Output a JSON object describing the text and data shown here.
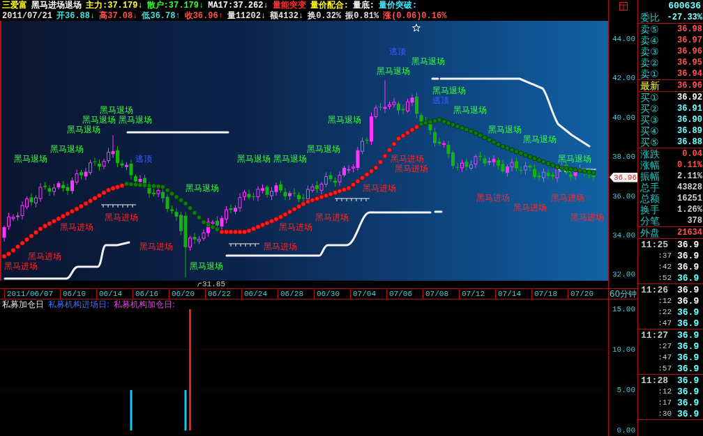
{
  "header": {
    "lines": [
      [
        {
          "text": "三爱富",
          "color": "#ffff00"
        },
        {
          "text": "黑马进场退场",
          "color": "#ffffff"
        },
        {
          "text": "主力:37.179↓",
          "color": "#ffff40"
        },
        {
          "text": "散户:37.179↓",
          "color": "#30ff30"
        },
        {
          "text": "MA17:37.262↓",
          "color": "#ffffff"
        },
        {
          "text": "量能突变",
          "color": "#ff3030"
        },
        {
          "text": "量价配合:",
          "color": "#ffff00"
        },
        {
          "text": "量底:",
          "color": "#ffffff"
        },
        {
          "text": "量价突破:",
          "color": "#40e8ff"
        }
      ],
      [
        {
          "text": "2011/07/21",
          "color": "#e0e0e0"
        },
        {
          "text": "开36.88↓",
          "color": "#40e0e0"
        },
        {
          "text": "高37.08↓",
          "color": "#ff5050"
        },
        {
          "text": "低36.78↑",
          "color": "#40e0e0"
        },
        {
          "text": "收36.96↑",
          "color": "#ff5050"
        },
        {
          "text": "量11202↓",
          "color": "#e0e0e0"
        },
        {
          "text": "额4132↓",
          "color": "#e0e0e0"
        },
        {
          "text": "换0.32%",
          "color": "#e0e0e0"
        },
        {
          "text": "振0.81%",
          "color": "#e0e0e0"
        },
        {
          "text": "涨(0.06)0.16%",
          "color": "#ff5050"
        }
      ]
    ]
  },
  "price_chart": {
    "signals": [
      {
        "kind": "top",
        "text": "逃顶"
      },
      {
        "kind": "exit",
        "text": "黑马退场"
      },
      {
        "kind": "exit",
        "text": "黑马退场"
      },
      {
        "kind": "exit",
        "text": "黑马退场"
      },
      {
        "kind": "top",
        "text": "逃顶"
      },
      {
        "kind": "exit",
        "text": "黑马退场"
      },
      {
        "kind": "exit",
        "text": "黑马退场"
      },
      {
        "kind": "exit",
        "text": "黑马退场"
      },
      {
        "kind": "exit",
        "text": "黑马退场"
      },
      {
        "kind": "exit",
        "text": "黑马退场"
      },
      {
        "kind": "exit",
        "text": "黑马退场"
      },
      {
        "kind": "exit",
        "text": "黑马退场"
      },
      {
        "kind": "exit",
        "text": "黑马退场"
      },
      {
        "kind": "exit",
        "text": "黑马退场"
      },
      {
        "kind": "exit",
        "text": "黑马退场"
      },
      {
        "kind": "exit",
        "text": "黑马退场"
      },
      {
        "kind": "top",
        "text": "逃顶"
      },
      {
        "kind": "exit",
        "text": "黑马退场"
      },
      {
        "kind": "exit",
        "text": "黑马退场"
      },
      {
        "kind": "entry",
        "text": "黑马进场"
      },
      {
        "kind": "exit",
        "text": "黑马退场"
      },
      {
        "kind": "entry",
        "text": "黑马进场"
      },
      {
        "kind": "exit",
        "text": "黑马退场"
      },
      {
        "kind": "entry",
        "text": "黑马进场"
      },
      {
        "kind": "entry",
        "text": "黑马进场"
      },
      {
        "kind": "entry",
        "text": "黑马进场"
      },
      {
        "kind": "entry",
        "text": "黑马进场"
      },
      {
        "kind": "entry",
        "text": "黑马进场"
      },
      {
        "kind": "entry",
        "text": "黑马进场"
      },
      {
        "kind": "entry",
        "text": "黑马进场"
      },
      {
        "kind": "entry",
        "text": "黑马进场"
      },
      {
        "kind": "entry",
        "text": "黑马进场"
      },
      {
        "kind": "entry",
        "text": "黑马进场"
      },
      {
        "kind": "entry",
        "text": "黑马进场"
      },
      {
        "kind": "entry",
        "text": "黑马进场"
      },
      {
        "kind": "entry",
        "text": "黑马进场"
      },
      {
        "kind": "exit",
        "text": "黑马退场"
      }
    ],
    "low_label": "31.85"
  },
  "date_axis": {
    "dates": [
      "2011/06/07",
      "06/10",
      "06/14",
      "06/16",
      "06/20",
      "06/22",
      "06/24",
      "06/28",
      "06/30",
      "07/04",
      "07/06",
      "07/08",
      "07/12",
      "07/14",
      "07/18",
      "07/20"
    ]
  },
  "indicator": {
    "title": "私募加仓日",
    "legend": [
      {
        "text": "私募机构进场日:",
        "color": "#3a6cff"
      },
      {
        "text": "私募机构加仓日:",
        "color": "#e040e0"
      }
    ],
    "chart_data": {
      "type": "bar",
      "categories": [
        null,
        null,
        null,
        null,
        null,
        null,
        null,
        null,
        null,
        null,
        null,
        null,
        null,
        null,
        null,
        null,
        null,
        null,
        null,
        null,
        null,
        null,
        null,
        null,
        null,
        null,
        null,
        null,
        null,
        null,
        null,
        null,
        null,
        null,
        null,
        null,
        null,
        null,
        null,
        null,
        null,
        null,
        null,
        null,
        null,
        null,
        null,
        null,
        null,
        null,
        null,
        null,
        null,
        null,
        null,
        null,
        null,
        null,
        null,
        null,
        null,
        null,
        null,
        null,
        null,
        null,
        null,
        null,
        null,
        null,
        null,
        null,
        null,
        null,
        null,
        null,
        null,
        null,
        null,
        null,
        null,
        null,
        null,
        null,
        null,
        null,
        null,
        null,
        null,
        null,
        null,
        null,
        null,
        null,
        null,
        null,
        null,
        null,
        null,
        null,
        null,
        null,
        null,
        null,
        null,
        null,
        null,
        null,
        null,
        null,
        null,
        null,
        null,
        null,
        null,
        null,
        null,
        null,
        null,
        null,
        null,
        null,
        null,
        null,
        null,
        null,
        null,
        null,
        null,
        null,
        null,
        null,
        null,
        null
      ],
      "ylim": [
        0,
        15
      ],
      "yticks": [
        {
          "value": 0,
          "label": "0.00"
        },
        {
          "value": 5,
          "label": "5.00"
        },
        {
          "value": 10,
          "label": "10.00"
        },
        {
          "value": 15,
          "label": "15.00"
        }
      ],
      "series": [
        {
          "color": "#10c8f0",
          "values": [
            null,
            null,
            null,
            null,
            null,
            null,
            null,
            null,
            null,
            null,
            null,
            null,
            null,
            null,
            null,
            null,
            null,
            null,
            null,
            null,
            null,
            null,
            null,
            null,
            null,
            null,
            null,
            null,
            5,
            null,
            null,
            null,
            null,
            null,
            null,
            null,
            null,
            null,
            null,
            null,
            5,
            null,
            null,
            null,
            null,
            null,
            null,
            null,
            null,
            null,
            null,
            null,
            null,
            null,
            null,
            null,
            null,
            null,
            null,
            null,
            null,
            null,
            null,
            null,
            null,
            null,
            null,
            null,
            null,
            null,
            null,
            null,
            null,
            null,
            null,
            null,
            null,
            null,
            null,
            null,
            null,
            null,
            null,
            null,
            null,
            null,
            null,
            null,
            null,
            null,
            null,
            null,
            null,
            null,
            null,
            null,
            null,
            null,
            null,
            null,
            null,
            null,
            null,
            null,
            null,
            null,
            null,
            null,
            null,
            null,
            null,
            null,
            null,
            null,
            null,
            null,
            null,
            null,
            null,
            null,
            null,
            null,
            null,
            null,
            null,
            null,
            null,
            null,
            null,
            null,
            null,
            null,
            null,
            null
          ]
        },
        {
          "color": "#e02810",
          "values": [
            null,
            null,
            null,
            null,
            null,
            null,
            null,
            null,
            null,
            null,
            null,
            null,
            null,
            null,
            null,
            null,
            null,
            null,
            null,
            null,
            null,
            null,
            null,
            null,
            null,
            null,
            null,
            null,
            null,
            null,
            null,
            null,
            null,
            null,
            null,
            null,
            null,
            null,
            null,
            null,
            null,
            15,
            null,
            null,
            null,
            null,
            null,
            null,
            null,
            null,
            null,
            null,
            null,
            null,
            null,
            null,
            null,
            null,
            null,
            null,
            null,
            null,
            null,
            null,
            null,
            null,
            null,
            null,
            null,
            null,
            null,
            null,
            null,
            null,
            null,
            null,
            null,
            null,
            null,
            null,
            null,
            null,
            null,
            null,
            null,
            null,
            null,
            null,
            null,
            null,
            null,
            null,
            null,
            null,
            null,
            null,
            null,
            null,
            null,
            null,
            null,
            null,
            null,
            null,
            null,
            null,
            null,
            null,
            null,
            null,
            null,
            null,
            null,
            null,
            null,
            null,
            null,
            null,
            null,
            null,
            null,
            null,
            null,
            null,
            null,
            null,
            null,
            null,
            null,
            null,
            null,
            null,
            null,
            null
          ]
        }
      ]
    }
  },
  "price_axis": {
    "ticks": [
      "44.00",
      "42.00",
      "40.00",
      "38.00",
      "36.00",
      "34.00",
      "32.00"
    ],
    "current": "36.96"
  },
  "period": "60分钟",
  "quote_panel": {
    "code": "600636",
    "sections": [
      [
        {
          "kind": "quote",
          "label": "委比",
          "value": "-27.33%",
          "color": "#80ffff"
        }
      ],
      [
        {
          "kind": "quote",
          "label": "卖⑤",
          "value": "36.98",
          "color": "#ff5050"
        },
        {
          "kind": "quote",
          "label": "卖④",
          "value": "36.97",
          "color": "#ff5050"
        },
        {
          "kind": "quote",
          "label": "卖③",
          "value": "36.96",
          "color": "#ff5050"
        },
        {
          "kind": "quote",
          "label": "卖②",
          "value": "36.95",
          "color": "#ff5050"
        },
        {
          "kind": "quote",
          "label": "卖①",
          "value": "36.94",
          "color": "#ff5050"
        }
      ],
      [
        {
          "kind": "latest",
          "label": "最新",
          "value": "36.96",
          "color": "#ff5050"
        }
      ],
      [
        {
          "kind": "quote",
          "label": "买①",
          "value": "36.92",
          "color": "#ffffff"
        },
        {
          "kind": "quote",
          "label": "买②",
          "value": "36.91",
          "color": "#70ffff"
        },
        {
          "kind": "quote",
          "label": "买③",
          "value": "36.90",
          "color": "#70ffff"
        },
        {
          "kind": "quote",
          "label": "买④",
          "value": "36.89",
          "color": "#70ffff"
        },
        {
          "kind": "quote",
          "label": "买⑤",
          "value": "36.88",
          "color": "#70ffff"
        }
      ],
      [
        {
          "kind": "quote",
          "label": "涨跌",
          "value": "0.04",
          "color": "#ff5050"
        },
        {
          "kind": "quote",
          "label": "涨幅",
          "value": "0.11%",
          "color": "#ff5050"
        },
        {
          "kind": "quote",
          "label": "振幅",
          "value": "2.11%",
          "color": "#d0d0d0"
        },
        {
          "kind": "quote",
          "label": "总手",
          "value": "43828",
          "color": "#d0d0d0"
        },
        {
          "kind": "quote",
          "label": "总额",
          "value": "16251",
          "color": "#d0d0d0"
        },
        {
          "kind": "quote",
          "label": "换手",
          "value": "1.26%",
          "color": "#d0d0d0"
        },
        {
          "kind": "quote",
          "label": "分笔",
          "value": "378",
          "color": "#d0d0d0"
        }
      ],
      [
        {
          "kind": "quote",
          "label": "外盘",
          "value": "21634",
          "color": "#ff5050"
        }
      ]
    ],
    "trades": [
      [
        {
          "time": "11:25",
          "price": "36.9",
          "color": "#ffffff"
        },
        {
          "time": ":37",
          "price": "36.9",
          "color": "#ffffff"
        },
        {
          "time": ":42",
          "price": "36.9",
          "color": "#ffffff"
        },
        {
          "time": ":52",
          "price": "36.9",
          "color": "#70ffff"
        }
      ],
      [
        {
          "time": "11:26",
          "price": "36.9",
          "color": "#ffffff"
        },
        {
          "time": ":12",
          "price": "36.9",
          "color": "#ffffff"
        },
        {
          "time": ":22",
          "price": "36.9",
          "color": "#70ffff"
        },
        {
          "time": ":47",
          "price": "36.9",
          "color": "#70ffff"
        }
      ],
      [
        {
          "time": "11:27",
          "price": "36.9",
          "color": "#70ffff"
        },
        {
          "time": ":27",
          "price": "36.9",
          "color": "#70ffff"
        },
        {
          "time": ":47",
          "price": "36.9",
          "color": "#70ffff"
        },
        {
          "time": ":57",
          "price": "36.9",
          "color": "#70ffff"
        }
      ],
      [
        {
          "time": "11:28",
          "price": "36.9",
          "color": "#70ffff"
        },
        {
          "time": ":12",
          "price": "36.9",
          "color": "#70ffff"
        },
        {
          "time": ":17",
          "price": "36.9",
          "color": "#70ffff"
        },
        {
          "time": ":30",
          "price": "36.9",
          "color": "#70ffff"
        }
      ]
    ]
  }
}
